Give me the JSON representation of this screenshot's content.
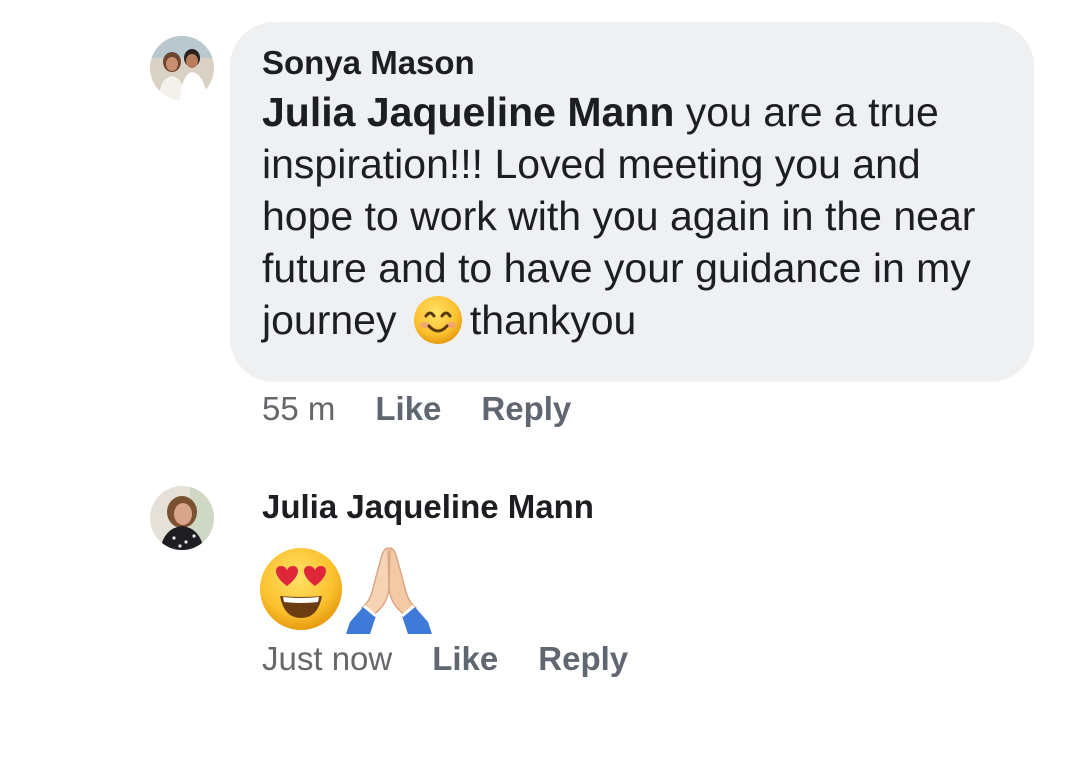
{
  "comments": [
    {
      "author": "Sonya Mason",
      "mention": "Julia Jaqueline Mann",
      "text_before_emoji": " you are a true inspiration!!! Loved meeting you and hope to work with you again in the near future and to have your guidance in my journey",
      "inline_emoji": "smiling-face-with-smiling-eyes",
      "text_after_emoji": "thankyou",
      "time": "55 m",
      "like_label": "Like",
      "reply_label": "Reply"
    },
    {
      "author": "Julia Jaqueline Mann",
      "emojis": [
        "heart-eyes-face",
        "folded-hands"
      ],
      "time": "Just now",
      "like_label": "Like",
      "reply_label": "Reply"
    }
  ],
  "colors": {
    "bubble": "#eff0f2",
    "text": "#1c1e21",
    "meta": "#65676b"
  }
}
